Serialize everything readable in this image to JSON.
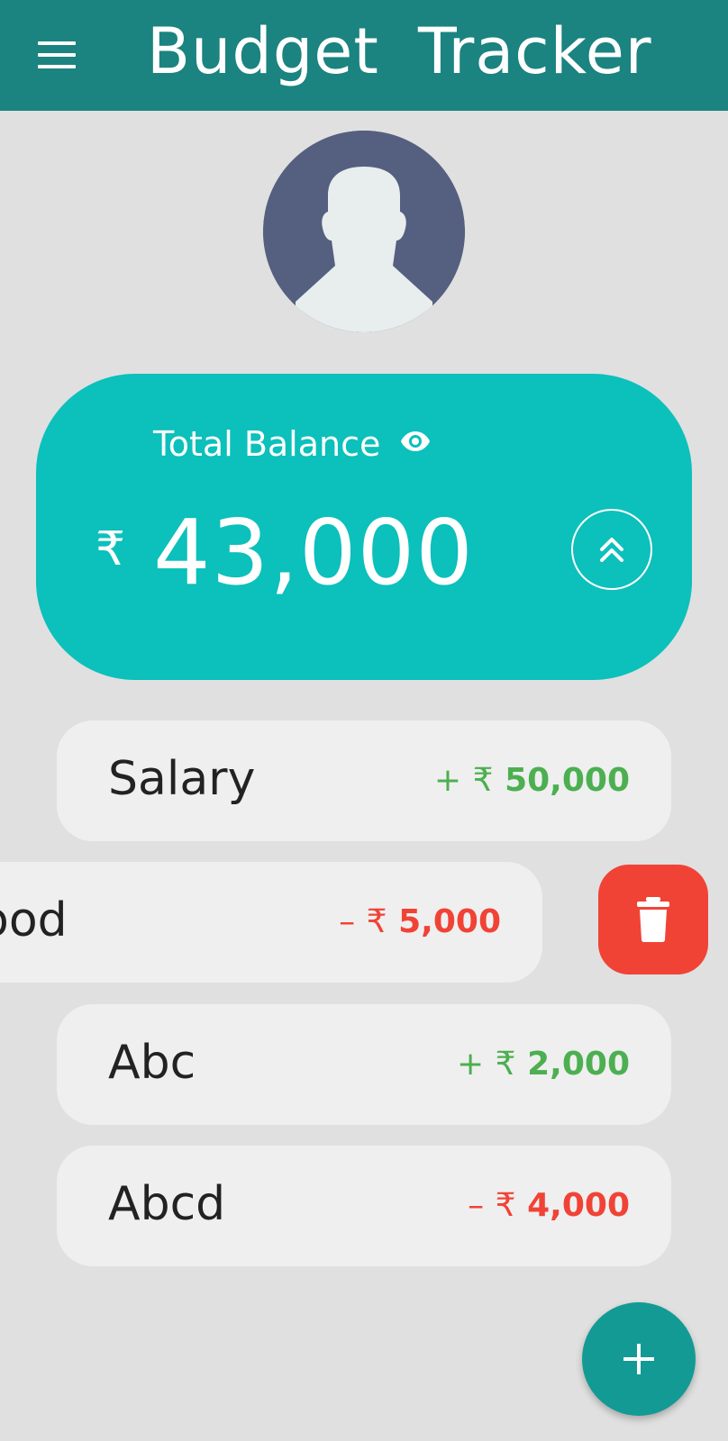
{
  "app_bar": {
    "title": "Budget  Tracker",
    "background": "#1b8380",
    "menu_icon": "hamburger-menu-icon"
  },
  "profile": {
    "avatar_icon": "user-silhouette-icon",
    "avatar_bg": "#556080"
  },
  "balance": {
    "label": "Total Balance",
    "visibility_icon": "eye-icon",
    "currency": "₹",
    "amount": "43,000",
    "expand_icon": "double-chevron-up-icon",
    "card_color": "#0cc0bb"
  },
  "transactions": [
    {
      "name": "Salary",
      "sign": "+",
      "currency": "₹",
      "amount": "50,000",
      "type": "income",
      "color": "#4caf50"
    },
    {
      "name": "Food",
      "visible_name": "ood",
      "sign": "–",
      "currency": "₹",
      "amount": "5,000",
      "type": "expense",
      "color": "#f04336",
      "swiped": true
    },
    {
      "name": "Abc",
      "sign": "+",
      "currency": "₹",
      "amount": "2,000",
      "type": "income",
      "color": "#4caf50"
    },
    {
      "name": "Abcd",
      "sign": "–",
      "currency": "₹",
      "amount": "4,000",
      "type": "expense",
      "color": "#f04336"
    }
  ],
  "delete_action": {
    "icon": "trash-icon",
    "color": "#f04336"
  },
  "fab": {
    "icon": "plus-icon",
    "color": "#139a94"
  }
}
